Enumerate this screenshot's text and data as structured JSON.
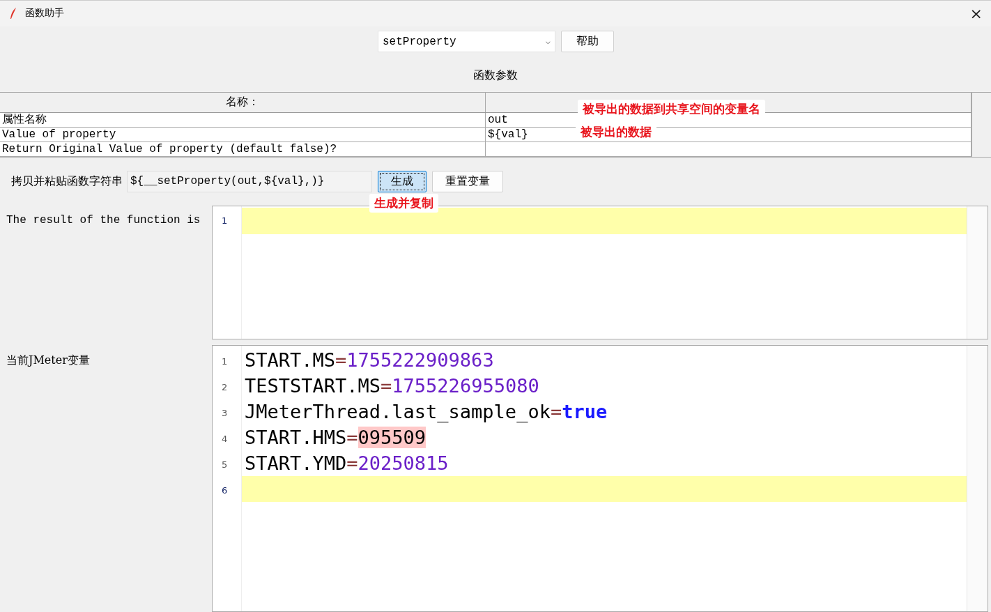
{
  "window": {
    "title": "函数助手",
    "close": "×"
  },
  "function_select": {
    "value": "setProperty",
    "caret": "⌵"
  },
  "help_button": "帮助",
  "section_title": "函数参数",
  "table": {
    "columns": [
      "名称："
    ],
    "rows": [
      {
        "name": "属性名称",
        "value": "out"
      },
      {
        "name": "Value of property",
        "value": "${val}"
      },
      {
        "name": "Return Original Value of property (default false)?"
      }
    ],
    "annotations": [
      "被导出的数据到共享空间的变量名",
      "被导出的数据"
    ]
  },
  "generate_row": {
    "label": "拷贝并粘贴函数字符串",
    "value": "${__setProperty(out,${val},)}",
    "buttons": [
      {
        "label": "生成",
        "focused": true
      },
      {
        "label": "重置变量",
        "focused": false
      }
    ],
    "annotation": "生成并复制"
  },
  "result": {
    "label": "The result of the function is",
    "lines": [
      {
        "number": "1",
        "current": true
      }
    ]
  },
  "variables": {
    "label": "当前JMeter变量",
    "lines": [
      {
        "number": "1",
        "key": "START.MS",
        "equals": "=",
        "value": "1755222909863",
        "kind": "number",
        "marked": false,
        "current": false
      },
      {
        "number": "2",
        "key": "TESTSTART.MS",
        "equals": "=",
        "value": "1755226955080",
        "kind": "number",
        "marked": false,
        "current": false
      },
      {
        "number": "3",
        "key": "JMeterThread.last_sample_ok",
        "equals": "=",
        "value": "true",
        "kind": "boolean",
        "marked": false,
        "current": false
      },
      {
        "number": "4",
        "key": "START.HMS",
        "equals": "=",
        "value": "095509",
        "kind": "number",
        "marked": true,
        "current": false
      },
      {
        "number": "5",
        "key": "START.YMD",
        "equals": "=",
        "value": "20250815",
        "kind": "number",
        "marked": false,
        "current": false
      },
      {
        "number": "6",
        "current": true
      }
    ]
  }
}
